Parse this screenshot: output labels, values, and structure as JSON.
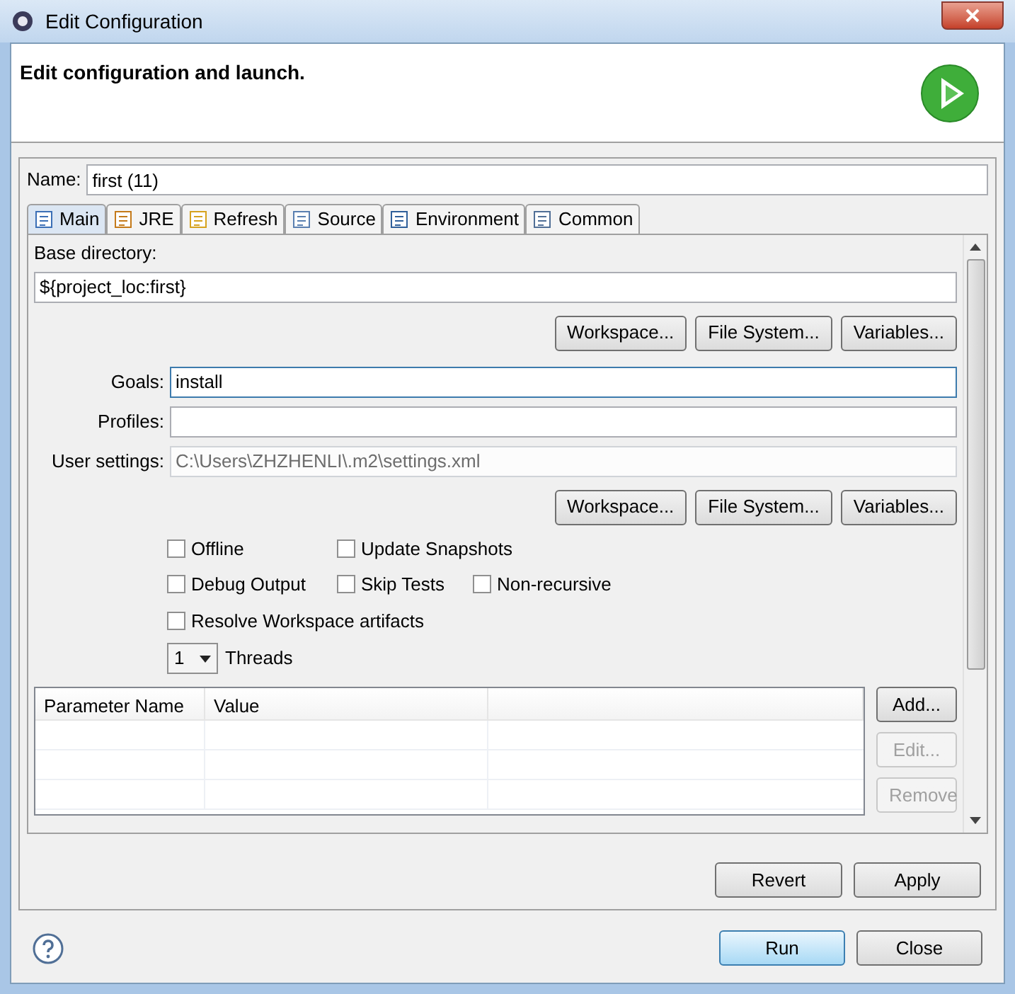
{
  "window": {
    "title": "Edit Configuration"
  },
  "header": {
    "message": "Edit configuration and launch."
  },
  "name": {
    "label": "Name:",
    "value": "first (11)"
  },
  "tabs": [
    {
      "label": "Main",
      "selected": true
    },
    {
      "label": "JRE",
      "selected": false
    },
    {
      "label": "Refresh",
      "selected": false
    },
    {
      "label": "Source",
      "selected": false
    },
    {
      "label": "Environment",
      "selected": false
    },
    {
      "label": "Common",
      "selected": false
    }
  ],
  "base_directory": {
    "label": "Base directory:",
    "value": "${project_loc:first}",
    "buttons": [
      "Workspace...",
      "File System...",
      "Variables..."
    ]
  },
  "fields": [
    {
      "label": "Goals:",
      "value": "install",
      "focused": true,
      "disabled": false
    },
    {
      "label": "Profiles:",
      "focused": false,
      "disabled": false
    },
    {
      "label": "User settings:",
      "value": "C:\\Users\\ZHZHENLI\\.m2\\settings.xml",
      "focused": false,
      "disabled": true
    }
  ],
  "settings_buttons": [
    "Workspace...",
    "File System...",
    "Variables..."
  ],
  "options": [
    [
      {
        "label": "Offline",
        "checked": false
      },
      {
        "label": "Update Snapshots",
        "checked": false
      }
    ],
    [
      {
        "label": "Debug Output",
        "checked": false
      },
      {
        "label": "Skip Tests",
        "checked": false
      },
      {
        "label": "Non-recursive",
        "checked": false
      }
    ],
    [
      {
        "label": "Resolve Workspace artifacts",
        "checked": false
      }
    ]
  ],
  "threads": {
    "value": "1",
    "label": "Threads"
  },
  "table": {
    "columns": [
      "Parameter Name",
      "Value"
    ],
    "buttons": [
      {
        "label": "Add...",
        "disabled": false
      },
      {
        "label": "Edit...",
        "disabled": true
      },
      {
        "label": "Remove",
        "disabled": true
      }
    ]
  },
  "actions": [
    "Revert",
    "Apply"
  ],
  "footer": [
    {
      "label": "Run",
      "default": true
    },
    {
      "label": "Close",
      "default": false
    }
  ]
}
